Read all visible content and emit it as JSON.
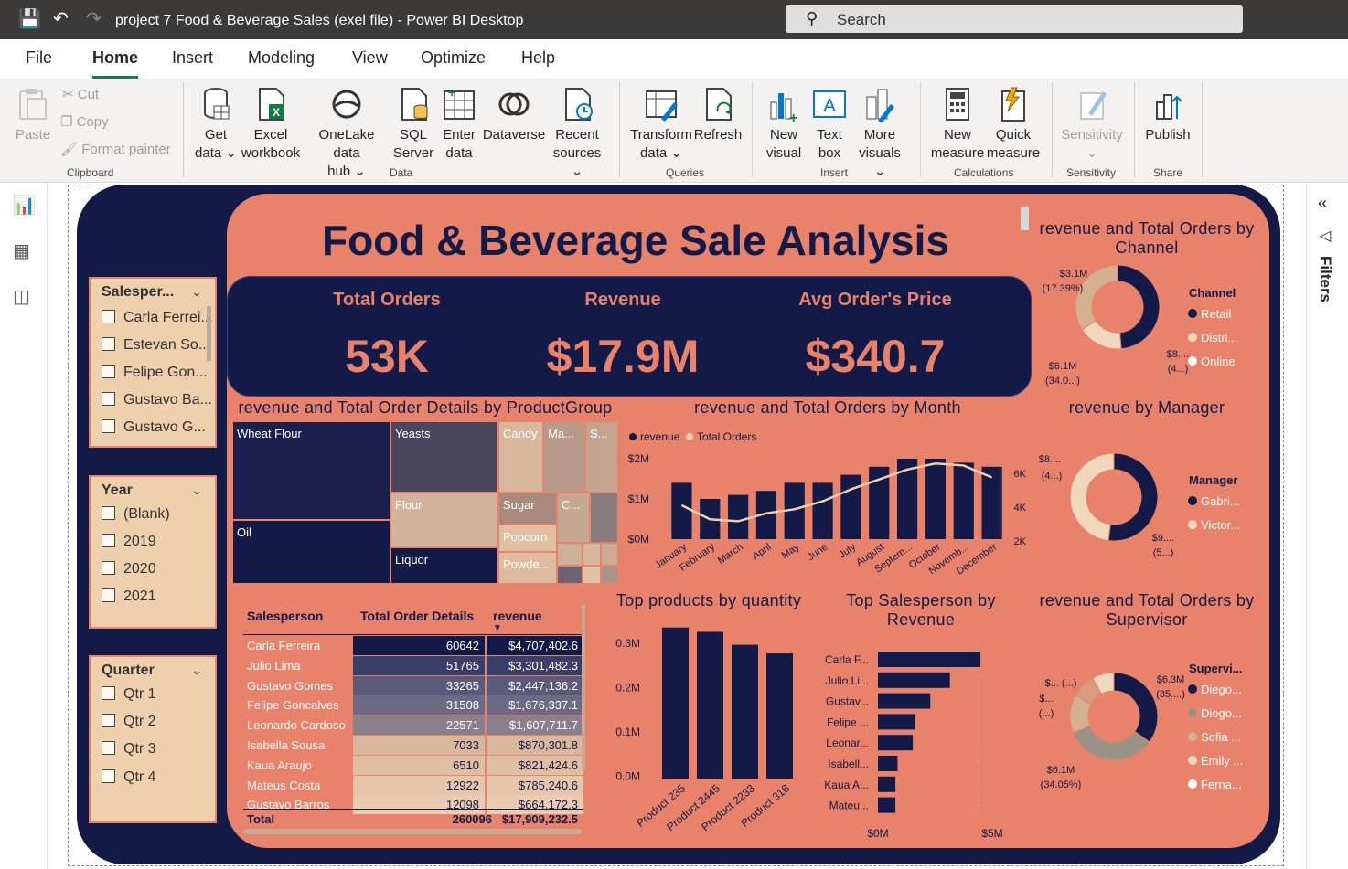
{
  "window": {
    "title": "project 7 Food & Beverage Sales (exel file) - Power BI Desktop",
    "search_placeholder": "Search"
  },
  "menu": {
    "tabs": [
      "File",
      "Home",
      "Insert",
      "Modeling",
      "View",
      "Optimize",
      "Help"
    ],
    "active": "Home"
  },
  "ribbon": {
    "clipboard": {
      "paste": "Paste",
      "cut": "Cut",
      "copy": "Copy",
      "format_painter": "Format painter",
      "group": "Clipboard"
    },
    "data": {
      "get_data_1": "Get",
      "get_data_2": "data",
      "excel_1": "Excel",
      "excel_2": "workbook",
      "onelake_1": "OneLake data",
      "onelake_2": "hub",
      "sql_1": "SQL",
      "sql_2": "Server",
      "enter_1": "Enter",
      "enter_2": "data",
      "dataverse": "Dataverse",
      "recent_1": "Recent",
      "recent_2": "sources",
      "group": "Data"
    },
    "queries": {
      "transform_1": "Transform",
      "transform_2": "data",
      "refresh": "Refresh",
      "group": "Queries"
    },
    "insert": {
      "newvis_1": "New",
      "newvis_2": "visual",
      "textbox_1": "Text",
      "textbox_2": "box",
      "more_1": "More",
      "more_2": "visuals",
      "group": "Insert"
    },
    "calc": {
      "newmeas_1": "New",
      "newmeas_2": "measure",
      "quick_1": "Quick",
      "quick_2": "measure",
      "group": "Calculations"
    },
    "sens": {
      "label": "Sensitivity",
      "group": "Sensitivity"
    },
    "share": {
      "publish": "Publish",
      "group": "Share"
    }
  },
  "filters_pane": {
    "label": "Filters"
  },
  "dashboard": {
    "title": "Food & Beverage Sale Analysis",
    "kpis": [
      {
        "label": "Total Orders",
        "value": "53K"
      },
      {
        "label": "Revenue",
        "value": "$17.9M"
      },
      {
        "label": "Avg Order's Price",
        "value": "$340.7"
      }
    ],
    "colors": {
      "navy": "#141a47",
      "salmon": "#e8826a",
      "sand": "#efd0ad",
      "taupe": "#b89a8a"
    }
  },
  "slicers": {
    "salesperson": {
      "title": "Salesper...",
      "options": [
        "Carla Ferrei...",
        "Estevan So...",
        "Felipe Gon...",
        "Gustavo Ba...",
        "Gustavo G..."
      ]
    },
    "year": {
      "title": "Year",
      "options": [
        "(Blank)",
        "2019",
        "2020",
        "2021"
      ]
    },
    "quarter": {
      "title": "Quarter",
      "options": [
        "Qtr 1",
        "Qtr 2",
        "Qtr 3",
        "Qtr 4"
      ]
    }
  },
  "treemap": {
    "title": "revenue and Total Order Details by ProductGroup",
    "tiles": [
      "Wheat Flour",
      "Yeasts",
      "Candy",
      "Ma...",
      "S...",
      "Oil",
      "Flour",
      "Sugar",
      "C...",
      "Popcorn",
      "Liquor",
      "Powde..."
    ]
  },
  "table": {
    "headers": [
      "Salesperson",
      "Total Order Details",
      "revenue"
    ],
    "rows": [
      [
        "Carla Ferreira",
        "60642",
        "$4,707,402.6"
      ],
      [
        "Julio Lima",
        "51765",
        "$3,301,482.3"
      ],
      [
        "Gustavo Gomes",
        "33265",
        "$2,447,136.2"
      ],
      [
        "Felipe Goncalves",
        "31508",
        "$1,676,337.1"
      ],
      [
        "Leonardo Cardoso",
        "22571",
        "$1,607,711.7"
      ],
      [
        "Isabella Sousa",
        "7033",
        "$870,301.8"
      ],
      [
        "Kaua Araujo",
        "6510",
        "$821,424.6"
      ],
      [
        "Mateus Costa",
        "12922",
        "$785,240.6"
      ],
      [
        "Gustavo Barros",
        "12098",
        "$664,172.3"
      ]
    ],
    "total": [
      "Total",
      "260096",
      "$17,909,232.5"
    ]
  },
  "chart_data": [
    {
      "type": "bar",
      "title": "revenue and Total Orders by Month",
      "legend": [
        "revenue",
        "Total Orders"
      ],
      "categories": [
        "January",
        "February",
        "March",
        "April",
        "May",
        "June",
        "July",
        "August",
        "Septem...",
        "October",
        "Novemb...",
        "December"
      ],
      "series": [
        {
          "name": "revenue",
          "axis": "left",
          "values": [
            1.4,
            1.0,
            1.1,
            1.2,
            1.4,
            1.4,
            1.6,
            1.8,
            2.0,
            2.0,
            1.9,
            1.8
          ]
        },
        {
          "name": "Total Orders",
          "axis": "right",
          "type": "line",
          "values": [
            3200,
            2500,
            2400,
            2800,
            3000,
            3400,
            4000,
            4500,
            5000,
            5300,
            5200,
            4600
          ]
        }
      ],
      "y_left_ticks": [
        "$2M",
        "$1M",
        "$0M"
      ],
      "y_right_ticks": [
        "6K",
        "4K",
        "2K"
      ]
    },
    {
      "type": "bar",
      "title": "Top products by quantity",
      "categories": [
        "Product 235",
        "Product 2445",
        "Product 2233",
        "Product 318"
      ],
      "values": [
        0.35,
        0.34,
        0.31,
        0.29
      ],
      "y_ticks": [
        "0.3M",
        "0.2M",
        "0.1M",
        "0.0M"
      ]
    },
    {
      "type": "bar",
      "orientation": "horizontal",
      "title": "Top Salesperson by Revenue",
      "categories": [
        "Carla F...",
        "Julio Li...",
        "Gustav...",
        "Felipe ...",
        "Leonar...",
        "Isabell...",
        "Kaua A...",
        "Mateu..."
      ],
      "values": [
        4.7,
        3.3,
        2.4,
        1.7,
        1.6,
        0.9,
        0.8,
        0.8
      ],
      "x_ticks": [
        "$0M",
        "$5M"
      ]
    },
    {
      "type": "pie",
      "title": "revenue and Total Orders by Channel",
      "legend_title": "Channel",
      "legend": [
        "Retail",
        "Distri...",
        "Online"
      ],
      "values": [
        17.39,
        34.0,
        48.6
      ],
      "labels": [
        "$3.1M",
        "(17.39%)",
        "$6.1M",
        "(34.0...)",
        "$8....",
        "(4...)"
      ]
    },
    {
      "type": "pie",
      "title": "revenue by Manager",
      "legend_title": "Manager",
      "legend": [
        "Gabri...",
        "Victor..."
      ],
      "values": [
        52,
        48
      ],
      "labels": [
        "$8....",
        "(4...)",
        "$9....",
        "(5...)"
      ]
    },
    {
      "type": "pie",
      "title": "revenue and Total Orders by Supervisor",
      "legend_title": "Supervi...",
      "legend": [
        "Diego...",
        "Diogo...",
        "Sofia ...",
        "Emily ...",
        "Ferna..."
      ],
      "values": [
        35,
        34.05,
        14,
        9,
        8
      ],
      "labels": [
        "$6.3M",
        "(35....)",
        "$6.1M",
        "(34.05%)",
        "$... (...)",
        "$...",
        "(...)"
      ]
    }
  ]
}
